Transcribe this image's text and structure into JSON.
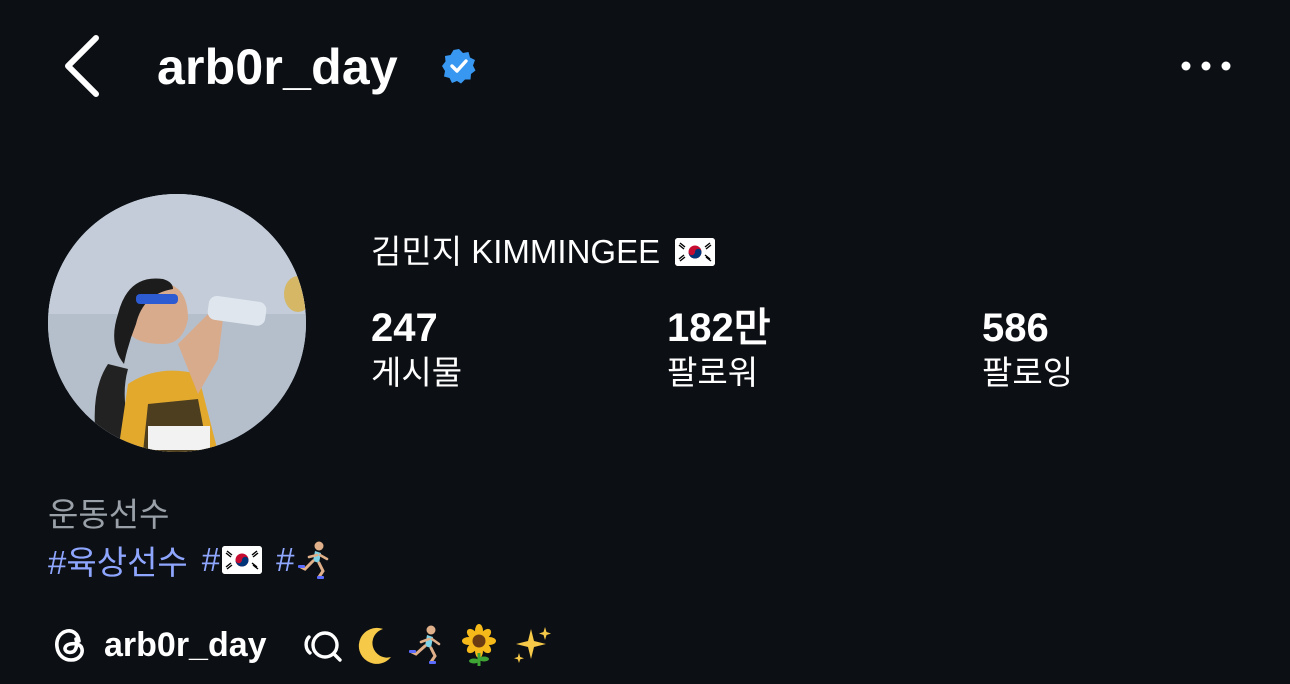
{
  "header": {
    "username": "arb0r_day",
    "verified": true,
    "back_icon": "chevron-left-icon",
    "more_icon": "more-horizontal-icon"
  },
  "profile": {
    "display_name": "김민지 KIMMINGEE",
    "display_name_flag": "south-korea-flag",
    "stats": [
      {
        "value": "247",
        "label": "게시물"
      },
      {
        "value": "182만",
        "label": "팔로워"
      },
      {
        "value": "586",
        "label": "팔로잉"
      }
    ],
    "category": "운동선수",
    "hashtags": [
      "#육상선수",
      "#",
      "#"
    ],
    "hashtag_emojis": [
      "",
      "south-korea-flag",
      "runner-emoji"
    ],
    "threads": {
      "icon": "threads-icon",
      "username": "arb0r_day",
      "badge_icon": "threads-chat-icon",
      "emojis": [
        "crescent-moon-emoji",
        "runner-emoji",
        "sunflower-emoji",
        "sparkles-emoji"
      ]
    }
  },
  "colors": {
    "background": "#0c0f14",
    "verified_blue": "#3897f0",
    "hashtag": "#8fa6ff",
    "category_gray": "#9aa0a8"
  }
}
